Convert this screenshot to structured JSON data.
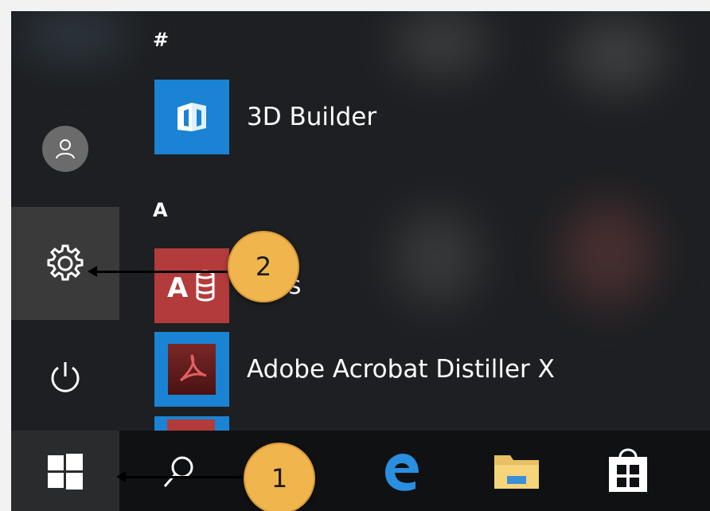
{
  "app_list": {
    "sections": [
      {
        "letter": "#",
        "apps": [
          {
            "name": "3D Builder",
            "icon": "3d-builder-icon",
            "tile_color": "#1a83d3"
          }
        ]
      },
      {
        "letter": "A",
        "apps": [
          {
            "name": "Access",
            "visible_name": "cess",
            "icon": "access-icon",
            "tile_color": "#b33b3b"
          },
          {
            "name": "Adobe Acrobat Distiller X",
            "icon": "acrobat-distiller-icon",
            "tile_color": "#1a83d3"
          }
        ]
      }
    ]
  },
  "left_rail": {
    "items": [
      {
        "name": "user-account",
        "icon": "user-icon"
      },
      {
        "name": "settings",
        "icon": "gear-icon"
      },
      {
        "name": "power",
        "icon": "power-icon"
      }
    ]
  },
  "taskbar": {
    "items": [
      {
        "name": "start",
        "icon": "windows-logo-icon"
      },
      {
        "name": "search",
        "icon": "search-icon"
      },
      {
        "name": "edge",
        "icon": "edge-icon"
      },
      {
        "name": "file-explorer",
        "icon": "folder-icon"
      },
      {
        "name": "store",
        "icon": "store-icon"
      }
    ]
  },
  "callouts": [
    {
      "label": "1",
      "points_to": "start"
    },
    {
      "label": "2",
      "points_to": "settings"
    }
  ],
  "colors": {
    "accent": "#1a83d3",
    "callout": "#f0b54d",
    "background": "#1d1f22"
  }
}
